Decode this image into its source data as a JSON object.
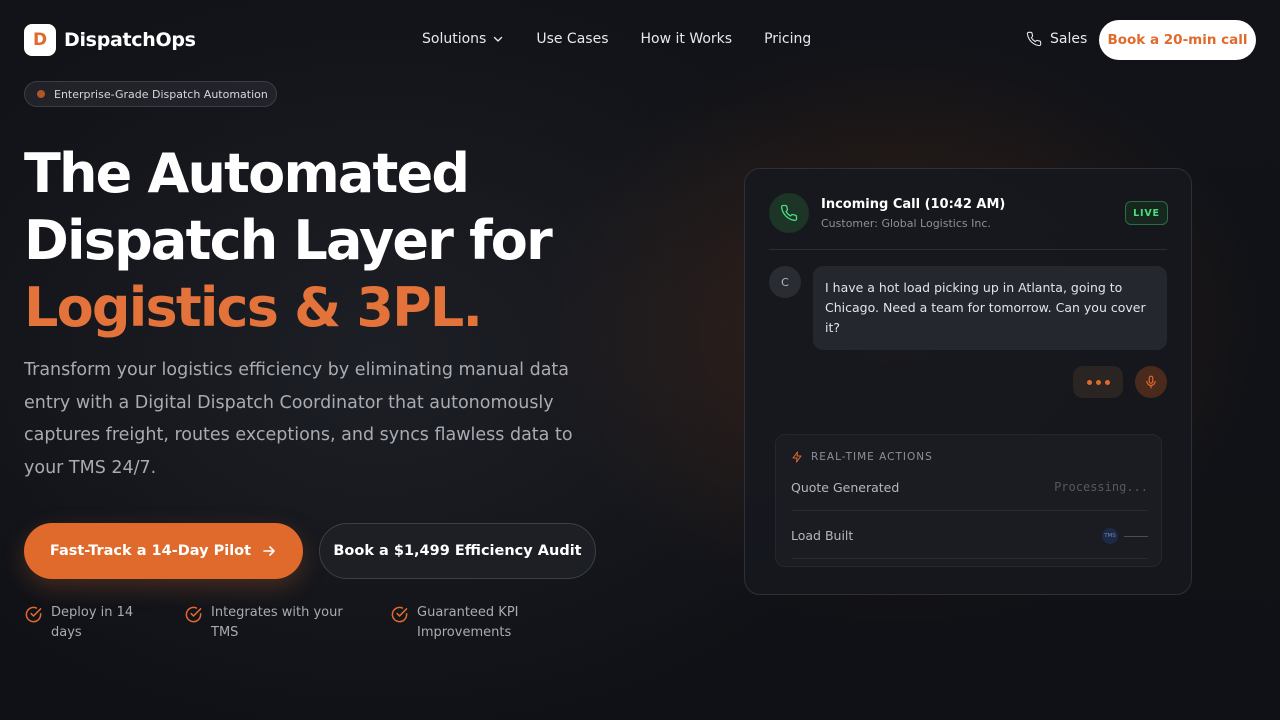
{
  "brand": {
    "mark": "D",
    "name": "DispatchOps"
  },
  "nav": {
    "links": [
      {
        "label": "Solutions",
        "has_dropdown": true
      },
      {
        "label": "Use Cases"
      },
      {
        "label": "How it Works"
      },
      {
        "label": "Pricing"
      }
    ],
    "sales_label": "Sales",
    "cta_label": "Book a 20-min call"
  },
  "badge": {
    "text": "Enterprise-Grade Dispatch Automation"
  },
  "hero": {
    "title_line1": "The Automated",
    "title_line2": "Dispatch Layer for",
    "title_accent": "Logistics & 3PL.",
    "subtitle": "Transform your logistics efficiency by eliminating manual data entry with a Digital Dispatch Coordinator that autonomously captures freight, routes exceptions, and syncs flawless data to your TMS 24/7.",
    "primary_cta": "Fast-Track a 14-Day Pilot",
    "secondary_cta": "Book a $1,499 Efficiency Audit",
    "features": [
      "Deploy in 14 days",
      "Integrates with your TMS",
      "Guaranteed KPI Improvements"
    ]
  },
  "call_card": {
    "title": "Incoming Call (10:42 AM)",
    "subtitle": "Customer: Global Logistics Inc.",
    "live_label": "LIVE",
    "avatar_initial": "C",
    "message": "I have a hot load picking up in Atlanta, going to Chicago. Need a team for tomorrow. Can you cover it?",
    "actions_header": "REAL-TIME ACTIONS",
    "actions": [
      {
        "label": "Quote Generated",
        "status": "Processing..."
      },
      {
        "label": "Load Built",
        "chip": "TMS"
      }
    ]
  },
  "colors": {
    "accent": "#e06a2c",
    "live": "#4ade80",
    "background": "#111318"
  },
  "icons": [
    "phone-icon",
    "chevron-down-icon",
    "arrow-right-icon",
    "check-circle-icon",
    "microphone-icon",
    "lightning-icon"
  ]
}
